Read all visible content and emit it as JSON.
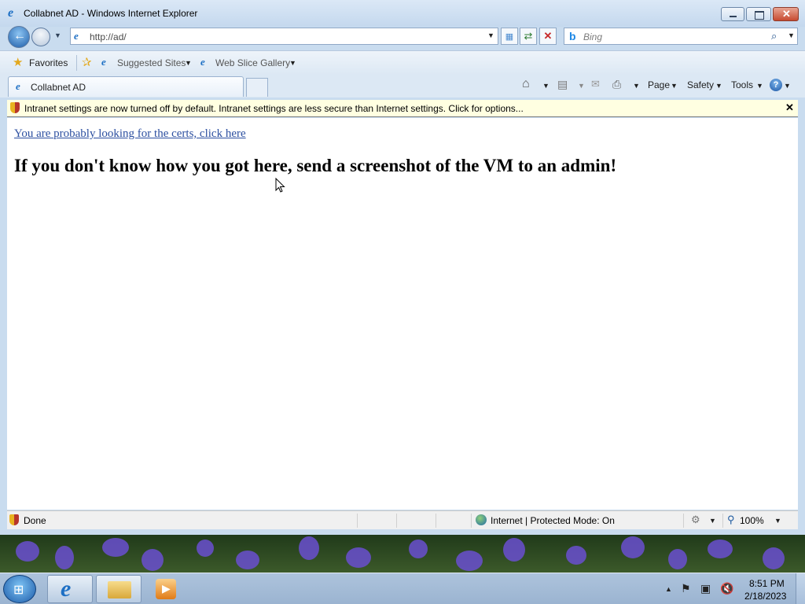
{
  "window": {
    "title": "Collabnet AD - Windows Internet Explorer",
    "controls": {
      "minimize": "",
      "maximize": "",
      "close": ""
    }
  },
  "nav": {
    "address": "http://ad/",
    "search_placeholder": "Bing"
  },
  "favorites_bar": {
    "favorites_label": "Favorites",
    "suggested_sites": "Suggested Sites",
    "web_slice_gallery": "Web Slice Gallery"
  },
  "tabs": [
    {
      "label": "Collabnet AD",
      "active": true
    }
  ],
  "command_bar": {
    "page": "Page",
    "safety": "Safety",
    "tools": "Tools"
  },
  "infobar": {
    "message": "Intranet settings are now turned off by default. Intranet settings are less secure than Internet settings. Click for options...",
    "close_glyph": "✕"
  },
  "content": {
    "link_text": "You are probably looking for the certs, click here",
    "heading": "If you don't know how you got here, send a screenshot of the VM to an admin!"
  },
  "statusbar": {
    "status": "Done",
    "zone": "Internet | Protected Mode: On",
    "zoom": "100%"
  },
  "taskbar": {
    "time": "8:51 PM",
    "date": "2/18/2023"
  },
  "colors": {
    "link": "#2c4fa0",
    "infobar_bg": "#ffffe1",
    "close_button": "#c74a30"
  }
}
